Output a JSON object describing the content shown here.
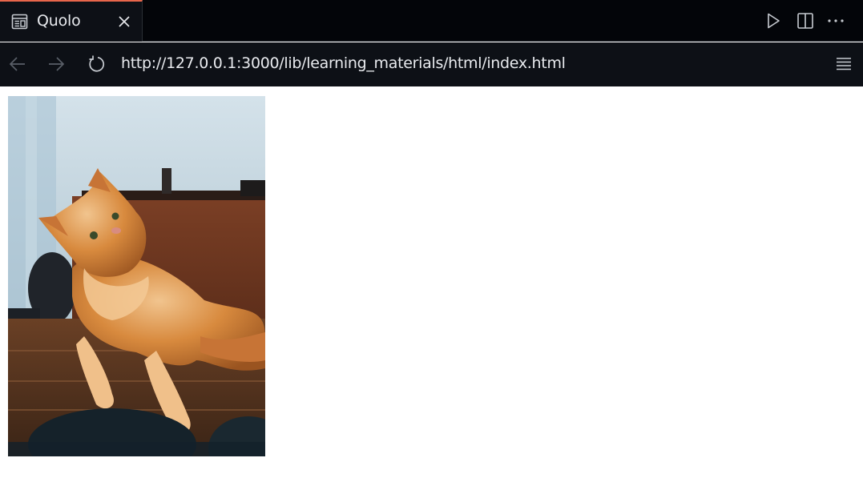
{
  "tab": {
    "title": "Quolo",
    "icon": "preview-icon",
    "close_icon": "close-icon",
    "accent_color": "#e8664b"
  },
  "editor_actions": [
    "run-icon",
    "split-editor-icon",
    "more-icon"
  ],
  "address_bar": {
    "back_icon": "arrow-left-icon",
    "forward_icon": "arrow-right-icon",
    "reload_icon": "reload-icon",
    "url": "http://127.0.0.1:3000/lib/learning_materials/html/index.html",
    "menu_icon": "menu-icon"
  },
  "page": {
    "image": "cat-photo",
    "background": "#ffffff"
  }
}
